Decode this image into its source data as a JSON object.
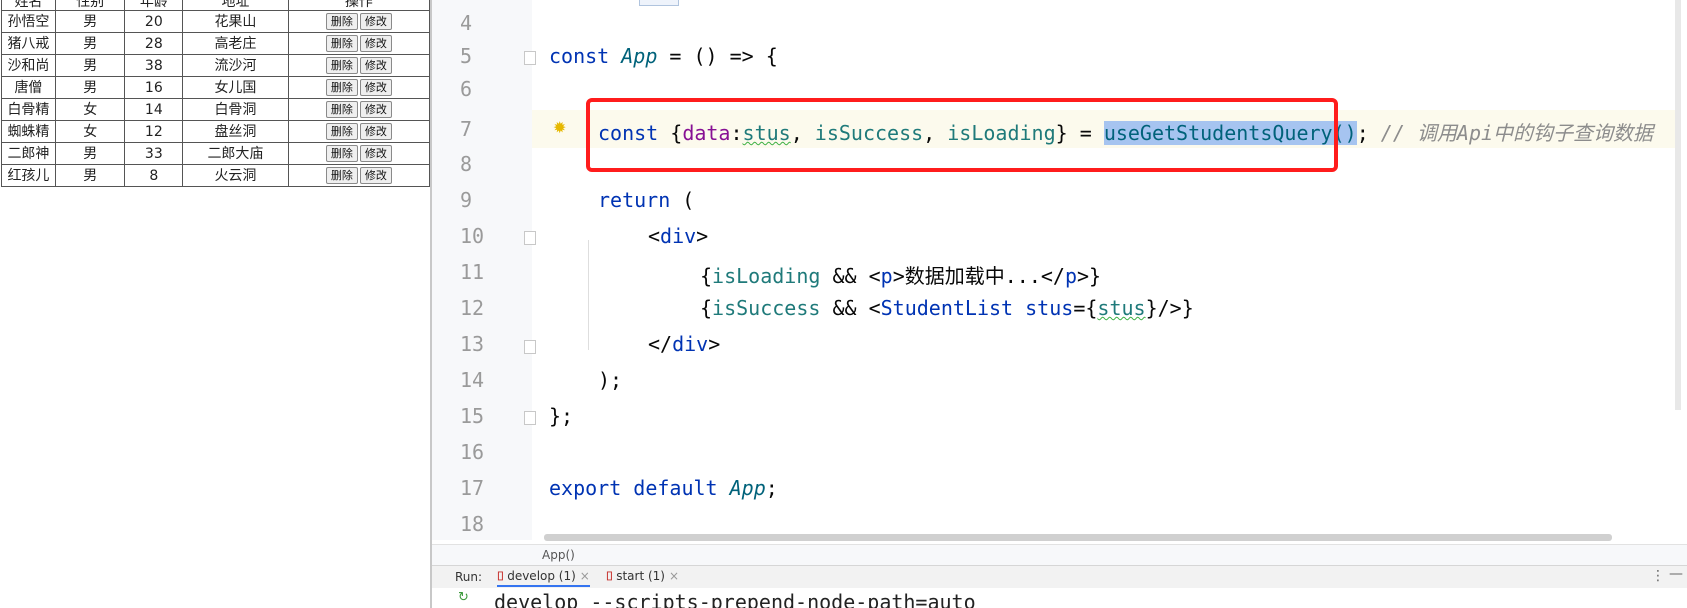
{
  "table": {
    "headers": [
      "姓名",
      "性别",
      "年龄",
      "地址",
      "操作"
    ],
    "rows": [
      [
        "孙悟空",
        "男",
        "20",
        "花果山"
      ],
      [
        "猪八戒",
        "男",
        "28",
        "高老庄"
      ],
      [
        "沙和尚",
        "男",
        "38",
        "流沙河"
      ],
      [
        "唐僧",
        "男",
        "16",
        "女儿国"
      ],
      [
        "白骨精",
        "女",
        "14",
        "白骨洞"
      ],
      [
        "蜘蛛精",
        "女",
        "12",
        "盘丝洞"
      ],
      [
        "二郎神",
        "男",
        "33",
        "二郎大庙"
      ],
      [
        "红孩儿",
        "男",
        "8",
        "火云洞"
      ]
    ],
    "delete_label": "删除",
    "edit_label": "修改"
  },
  "editor": {
    "line_numbers": [
      "4",
      "5",
      "6",
      "7",
      "8",
      "9",
      "10",
      "11",
      "12",
      "13",
      "14",
      "15",
      "16",
      "17",
      "18"
    ],
    "tokens": {
      "const": "const",
      "app": "App",
      "arrow": " = () => {",
      "brace_open": "{",
      "data": "data",
      "colon": ":",
      "stus": "stus",
      "comma1": ", ",
      "isSuccess": "isSuccess",
      "comma2": ", ",
      "isLoading": "isLoading",
      "brace_close_eq": "} = ",
      "hook": "useGetStudentsQuery()",
      "semi": ";",
      "comment": " // 调用Api中的钩子查询数据",
      "return": "return",
      "paren_open": " (",
      "div_open_lt": "<",
      "div": "div",
      "gt": ">",
      "p_expr_open": "{",
      "and": " && ",
      "p_lt": "<",
      "p": "p",
      "p_text": "数据加载中...",
      "p_close_lt": "</",
      "p_close_gt": ">}",
      "studentlist_lt": "<",
      "StudentList": "StudentList",
      "stus_attr": " stus",
      "eq_brace": "={",
      "self_close": "}/>}",
      "div_close_lt": "</",
      "paren_close": ");",
      "func_close": "};",
      "export": "export",
      "default": "default",
      "app_semi": ";"
    }
  },
  "breadcrumb": {
    "text": "App()"
  },
  "run": {
    "label": "Run:",
    "tabs": [
      {
        "label": "develop (1)",
        "close": "×"
      },
      {
        "label": "start (1)",
        "close": "×"
      }
    ],
    "menu": "⋮",
    "minimize": "—"
  },
  "console": {
    "output": "develop --scripts-prepend-node-path=auto"
  }
}
